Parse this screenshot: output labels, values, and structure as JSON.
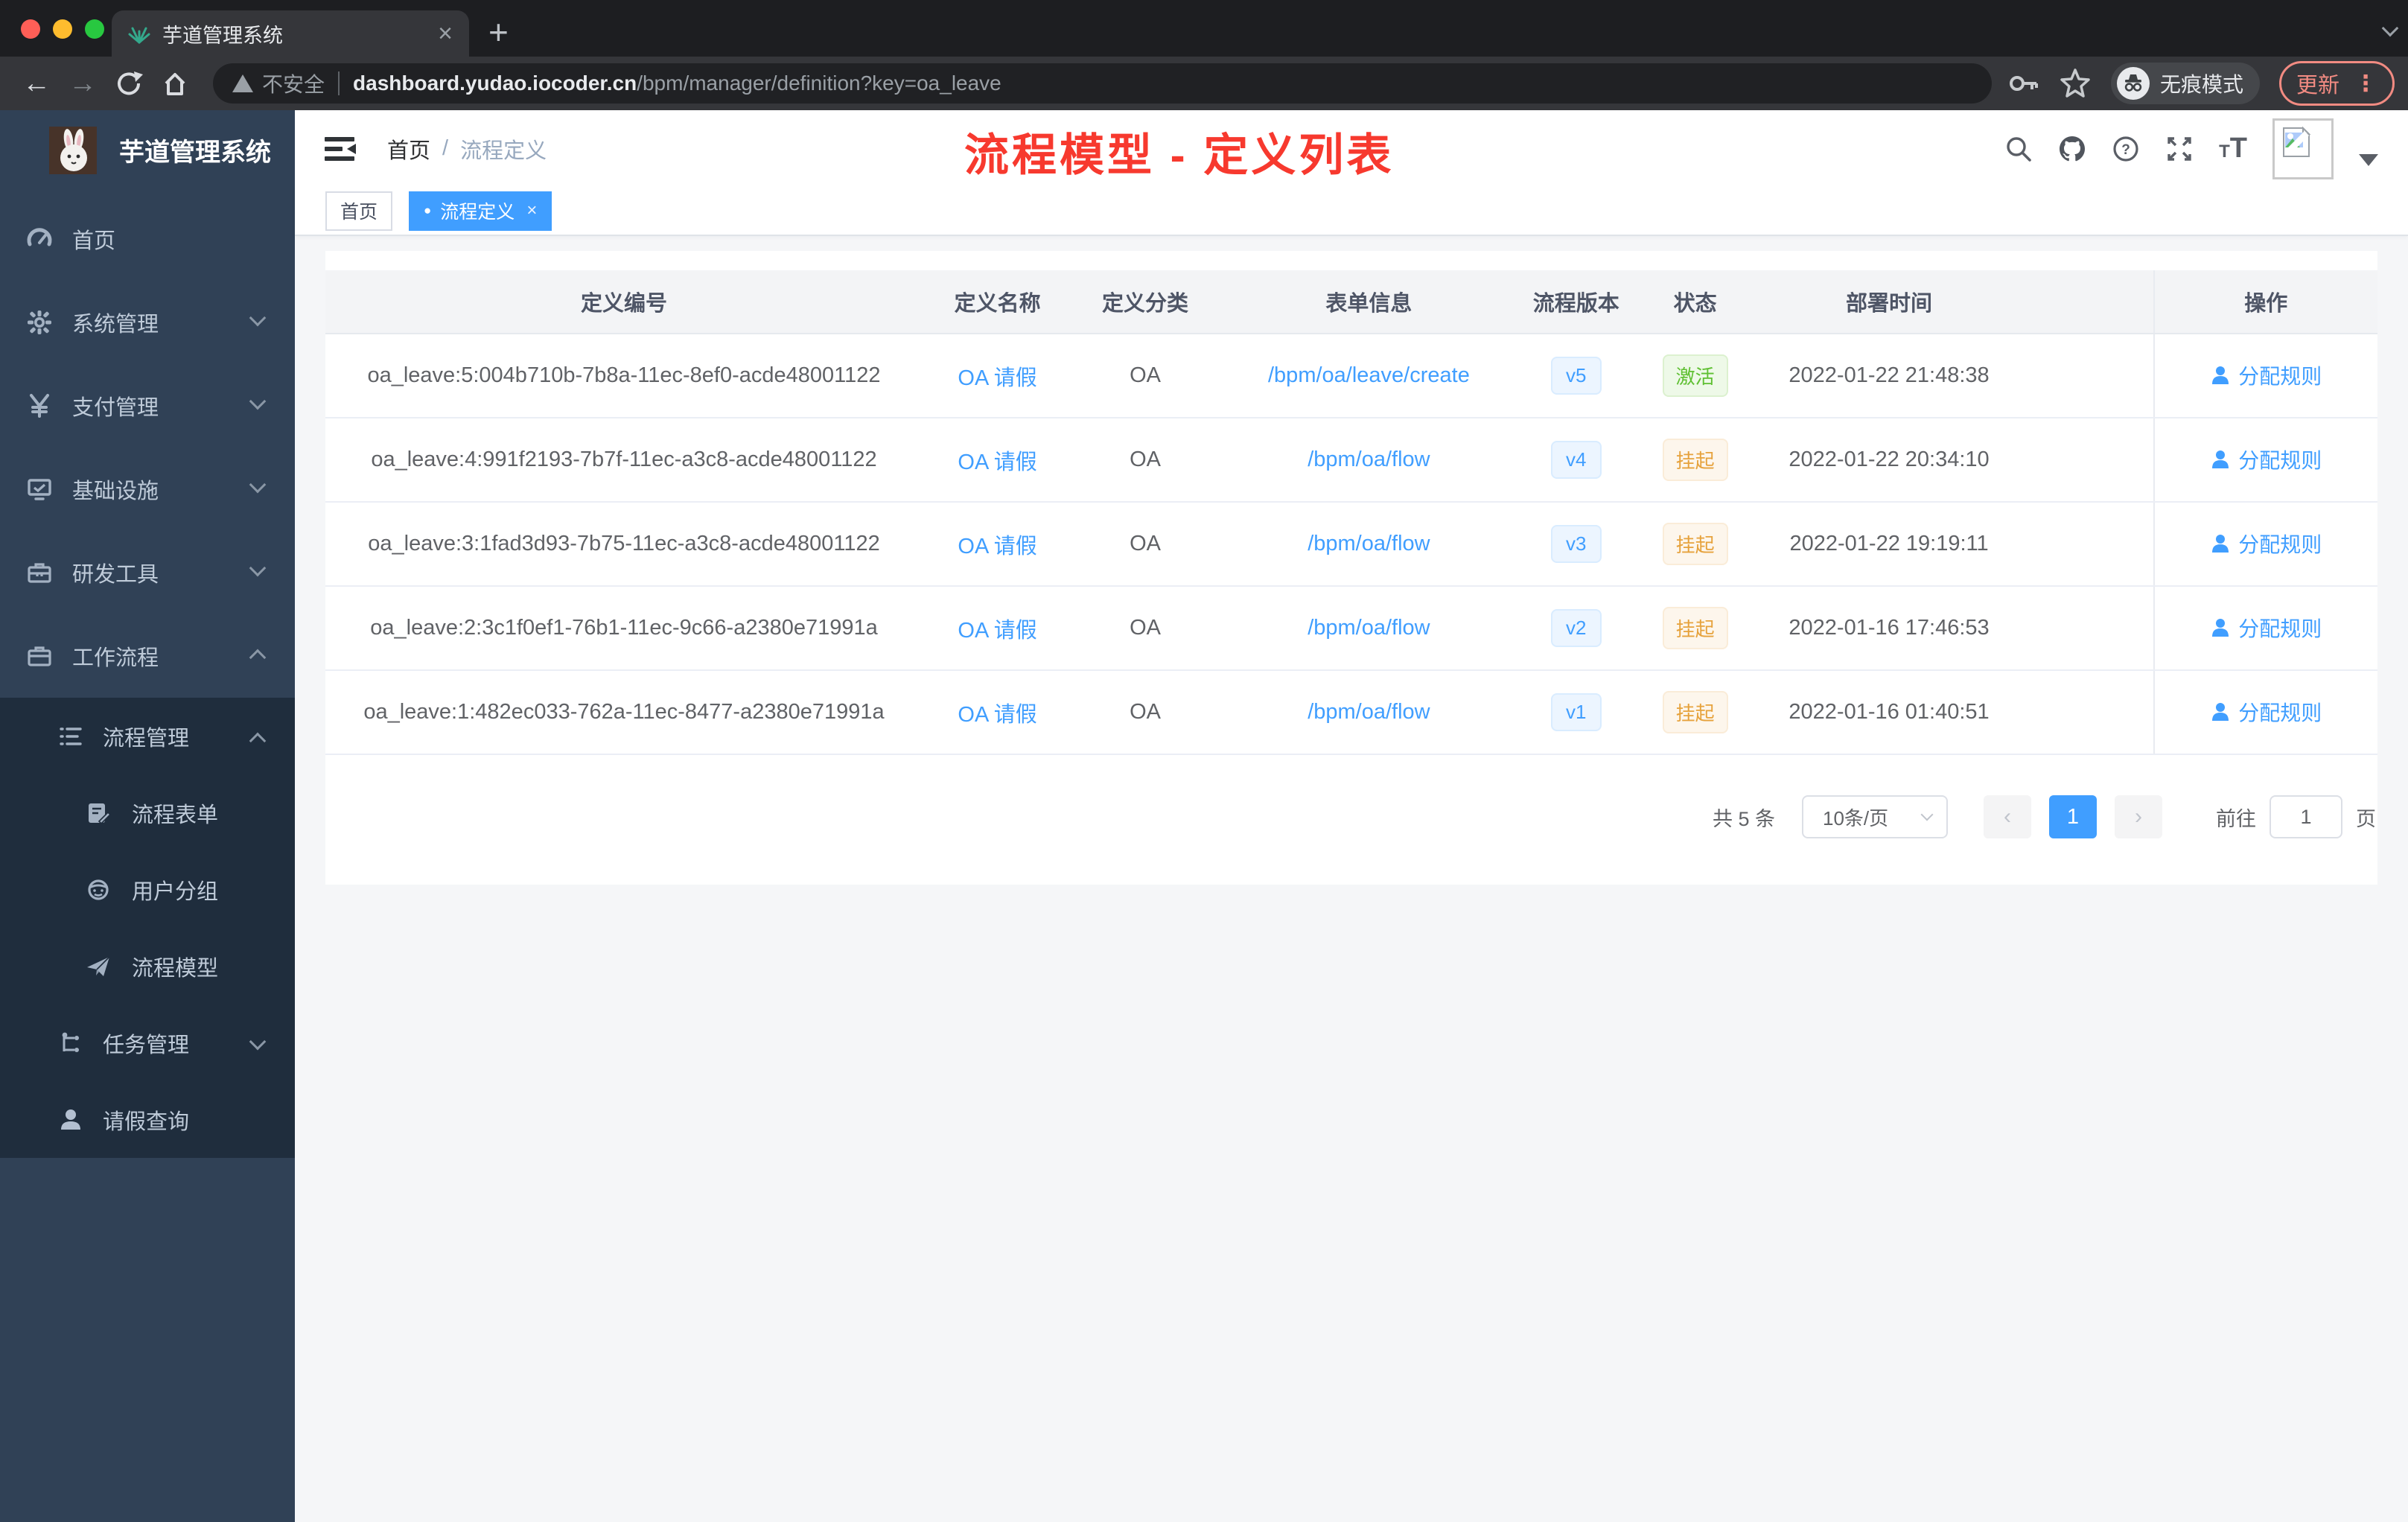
{
  "browser": {
    "tab_title": "芋道管理系统",
    "url": {
      "warning_label": "不安全",
      "domain": "dashboard.yudao.iocoder.cn",
      "path": "/bpm/manager/definition?key=oa_leave"
    },
    "incognito_label": "无痕模式",
    "update_label": "更新"
  },
  "icons": {
    "close": "×",
    "plus": "+",
    "back": "←",
    "forward": "→",
    "dot": "●",
    "more": "⋮",
    "prev": "‹",
    "next": "›",
    "breadcrumb_separator": "/"
  },
  "sidebar": {
    "app_title": "芋道管理系统",
    "items": [
      {
        "label": "首页",
        "icon": "gauge-icon"
      },
      {
        "label": "系统管理",
        "icon": "gear-icon"
      },
      {
        "label": "支付管理",
        "icon": "yen-icon"
      },
      {
        "label": "基础设施",
        "icon": "monitor-icon"
      },
      {
        "label": "研发工具",
        "icon": "toolbox-icon"
      },
      {
        "label": "工作流程",
        "icon": "briefcase-icon"
      },
      {
        "label": "流程管理",
        "icon": "list-icon"
      },
      {
        "label": "流程表单",
        "icon": "form-icon"
      },
      {
        "label": "用户分组",
        "icon": "user-group-icon"
      },
      {
        "label": "流程模型",
        "icon": "paper-plane-icon"
      },
      {
        "label": "任务管理",
        "icon": "tree-icon"
      },
      {
        "label": "请假查询",
        "icon": "person-icon"
      }
    ]
  },
  "header": {
    "breadcrumb": {
      "home": "首页",
      "current": "流程定义"
    }
  },
  "tags": {
    "items": [
      {
        "label": "首页"
      },
      {
        "label": "流程定义"
      }
    ]
  },
  "annotation": "流程模型 - 定义列表",
  "table": {
    "columns": [
      "定义编号",
      "定义名称",
      "定义分类",
      "表单信息",
      "流程版本",
      "状态",
      "部署时间",
      "操作"
    ],
    "rows": [
      {
        "id": "oa_leave:5:004b710b-7b8a-11ec-8ef0-acde48001122",
        "name": "OA 请假",
        "category": "OA",
        "form": "/bpm/oa/leave/create",
        "version": "v5",
        "status": "激活",
        "status_type": "success",
        "deploy_time": "2022-01-22 21:48:38",
        "action": "分配规则"
      },
      {
        "id": "oa_leave:4:991f2193-7b7f-11ec-a3c8-acde48001122",
        "name": "OA 请假",
        "category": "OA",
        "form": "/bpm/oa/flow",
        "version": "v4",
        "status": "挂起",
        "status_type": "warning",
        "deploy_time": "2022-01-22 20:34:10",
        "action": "分配规则"
      },
      {
        "id": "oa_leave:3:1fad3d93-7b75-11ec-a3c8-acde48001122",
        "name": "OA 请假",
        "category": "OA",
        "form": "/bpm/oa/flow",
        "version": "v3",
        "status": "挂起",
        "status_type": "warning",
        "deploy_time": "2022-01-22 19:19:11",
        "action": "分配规则"
      },
      {
        "id": "oa_leave:2:3c1f0ef1-76b1-11ec-9c66-a2380e71991a",
        "name": "OA 请假",
        "category": "OA",
        "form": "/bpm/oa/flow",
        "version": "v2",
        "status": "挂起",
        "status_type": "warning",
        "deploy_time": "2022-01-16 17:46:53",
        "action": "分配规则"
      },
      {
        "id": "oa_leave:1:482ec033-762a-11ec-8477-a2380e71991a",
        "name": "OA 请假",
        "category": "OA",
        "form": "/bpm/oa/flow",
        "version": "v1",
        "status": "挂起",
        "status_type": "warning",
        "deploy_time": "2022-01-16 01:40:51",
        "action": "分配规则"
      }
    ]
  },
  "pagination": {
    "total": "共 5 条",
    "page_size": "10条/页",
    "current_page": "1",
    "goto_label": "前往",
    "goto_value": "1",
    "page_unit": "页"
  },
  "colors": {
    "accent": "#409eff",
    "success": "#67c23a",
    "warning": "#e6a23c",
    "annotation_red": "#f7392e",
    "update_chip": "#f28b82"
  }
}
